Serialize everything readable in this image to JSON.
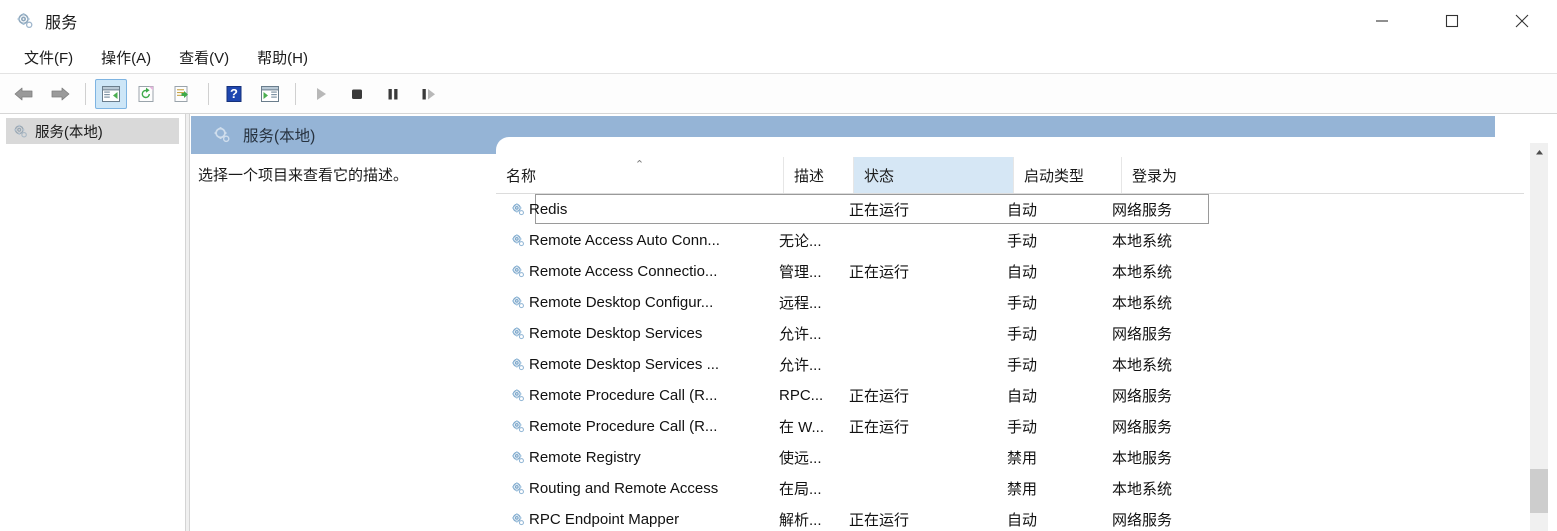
{
  "window": {
    "title": "服务",
    "icon": "services-gear-icon",
    "minimize_label": "最小化",
    "maximize_label": "最大化",
    "close_label": "关闭"
  },
  "menubar": {
    "items": [
      {
        "label": "文件(F)",
        "name": "menu-file"
      },
      {
        "label": "操作(A)",
        "name": "menu-action"
      },
      {
        "label": "查看(V)",
        "name": "menu-view"
      },
      {
        "label": "帮助(H)",
        "name": "menu-help"
      }
    ]
  },
  "toolbar": {
    "buttons": [
      {
        "name": "back-arrow-icon",
        "label": "后退"
      },
      {
        "name": "forward-arrow-icon",
        "label": "前进"
      },
      {
        "name": "show-hide-tree-icon",
        "label": "显示/隐藏控制台树"
      },
      {
        "name": "refresh-icon",
        "label": "刷新"
      },
      {
        "name": "export-list-icon",
        "label": "导出列表"
      },
      {
        "name": "help-icon",
        "label": "帮助"
      },
      {
        "name": "show-action-pane-icon",
        "label": "显示/隐藏操作窗格"
      },
      {
        "name": "start-service-icon",
        "label": "启动服务"
      },
      {
        "name": "stop-service-icon",
        "label": "停止服务"
      },
      {
        "name": "pause-service-icon",
        "label": "暂停服务"
      },
      {
        "name": "restart-service-icon",
        "label": "重启服务"
      }
    ]
  },
  "tree": {
    "nodes": [
      {
        "label": "服务(本地)",
        "name": "tree-node-services-local",
        "selected": true
      }
    ]
  },
  "detail": {
    "band_title": "服务(本地)",
    "description": "选择一个项目来查看它的描述。"
  },
  "list": {
    "columns": [
      {
        "key": "name",
        "label": "名称",
        "sorted": "asc"
      },
      {
        "key": "desc",
        "label": "描述",
        "sorted": ""
      },
      {
        "key": "state",
        "label": "状态",
        "sorted": "",
        "hover": true
      },
      {
        "key": "start",
        "label": "启动类型",
        "sorted": ""
      },
      {
        "key": "logon",
        "label": "登录为",
        "sorted": ""
      }
    ],
    "sort_caret": "⌃",
    "rows": [
      {
        "name": "Redis",
        "desc": "",
        "state": "正在运行",
        "start": "自动",
        "logon": "网络服务",
        "selected": true
      },
      {
        "name": "Remote Access Auto Conn...",
        "desc": "无论...",
        "state": "",
        "start": "手动",
        "logon": "本地系统",
        "selected": false
      },
      {
        "name": "Remote Access Connectio...",
        "desc": "管理...",
        "state": "正在运行",
        "start": "自动",
        "logon": "本地系统",
        "selected": false
      },
      {
        "name": "Remote Desktop Configur...",
        "desc": "远程...",
        "state": "",
        "start": "手动",
        "logon": "本地系统",
        "selected": false
      },
      {
        "name": "Remote Desktop Services",
        "desc": "允许...",
        "state": "",
        "start": "手动",
        "logon": "网络服务",
        "selected": false
      },
      {
        "name": "Remote Desktop Services ...",
        "desc": "允许...",
        "state": "",
        "start": "手动",
        "logon": "本地系统",
        "selected": false
      },
      {
        "name": "Remote Procedure Call (R...",
        "desc": "RPC...",
        "state": "正在运行",
        "start": "自动",
        "logon": "网络服务",
        "selected": false
      },
      {
        "name": "Remote Procedure Call (R...",
        "desc": "在 W...",
        "state": "正在运行",
        "start": "手动",
        "logon": "网络服务",
        "selected": false
      },
      {
        "name": "Remote Registry",
        "desc": "使远...",
        "state": "",
        "start": "禁用",
        "logon": "本地服务",
        "selected": false
      },
      {
        "name": "Routing and Remote Access",
        "desc": "在局...",
        "state": "",
        "start": "禁用",
        "logon": "本地系统",
        "selected": false
      },
      {
        "name": "RPC Endpoint Mapper",
        "desc": "解析...",
        "state": "正在运行",
        "start": "自动",
        "logon": "网络服务",
        "selected": false
      }
    ]
  },
  "scrollbar": {
    "up_glyph": "⌃",
    "down_glyph": "⌄"
  },
  "colors": {
    "band_blue": "#95b4d6",
    "header_hover": "#d6e7f5",
    "toolbar_active": "#cde6f7",
    "tree_selected": "#d9d9d9"
  }
}
